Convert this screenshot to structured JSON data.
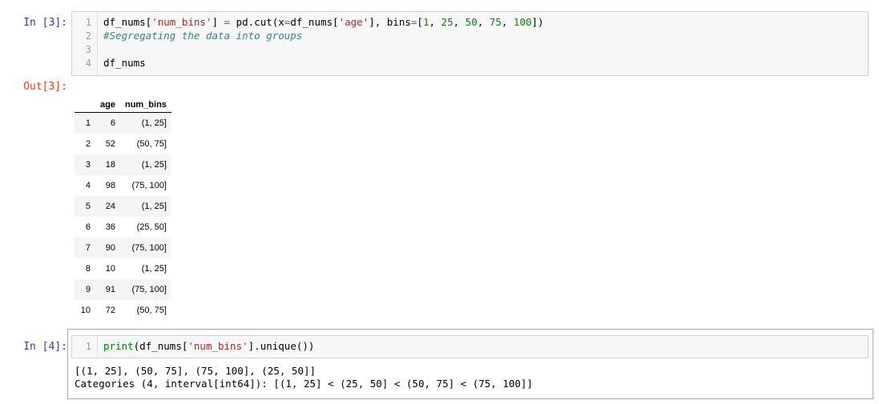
{
  "cell3": {
    "in_prompt": "In [3]:",
    "out_prompt": "Out[3]:",
    "line_numbers": [
      "1",
      "2",
      "3",
      "4"
    ],
    "code": {
      "l1": {
        "a": "df_nums[",
        "s1": "'num_bins'",
        "b": "] ",
        "eq": "=",
        "c": " pd.cut(x",
        "eq2": "=",
        "d": "df_nums[",
        "s2": "'age'",
        "e": "], bins",
        "eq3": "=",
        "f": "[",
        "n1": "1",
        "g": ", ",
        "n2": "25",
        "h": ", ",
        "n3": "50",
        "i": ", ",
        "n4": "75",
        "j": ", ",
        "n5": "100",
        "k": "])"
      },
      "l2": "#Segregating the data into groups",
      "l4": "df_nums"
    },
    "table": {
      "columns": [
        "age",
        "num_bins"
      ],
      "rows": [
        {
          "idx": "1",
          "age": "6",
          "num_bins": "(1, 25]"
        },
        {
          "idx": "2",
          "age": "52",
          "num_bins": "(50, 75]"
        },
        {
          "idx": "3",
          "age": "18",
          "num_bins": "(1, 25]"
        },
        {
          "idx": "4",
          "age": "98",
          "num_bins": "(75, 100]"
        },
        {
          "idx": "5",
          "age": "24",
          "num_bins": "(1, 25]"
        },
        {
          "idx": "6",
          "age": "36",
          "num_bins": "(25, 50]"
        },
        {
          "idx": "7",
          "age": "90",
          "num_bins": "(75, 100]"
        },
        {
          "idx": "8",
          "age": "10",
          "num_bins": "(1, 25]"
        },
        {
          "idx": "9",
          "age": "91",
          "num_bins": "(75, 100]"
        },
        {
          "idx": "10",
          "age": "72",
          "num_bins": "(50, 75]"
        }
      ]
    }
  },
  "cell4": {
    "in_prompt": "In [4]:",
    "line_number": "1",
    "code": {
      "fn": "print",
      "a": "(df_nums[",
      "s": "'num_bins'",
      "b": "].unique())"
    },
    "output": [
      "[(1, 25], (50, 75], (75, 100], (25, 50]]",
      "Categories (4, interval[int64]): [(1, 25] < (25, 50] < (50, 75] < (75, 100]]"
    ]
  },
  "colors": {
    "in_prompt": "#303f9f",
    "out_prompt": "#d84315",
    "string": "#ba2121",
    "number": "#008800",
    "comment": "#408080",
    "selected_border": "#ababab"
  }
}
